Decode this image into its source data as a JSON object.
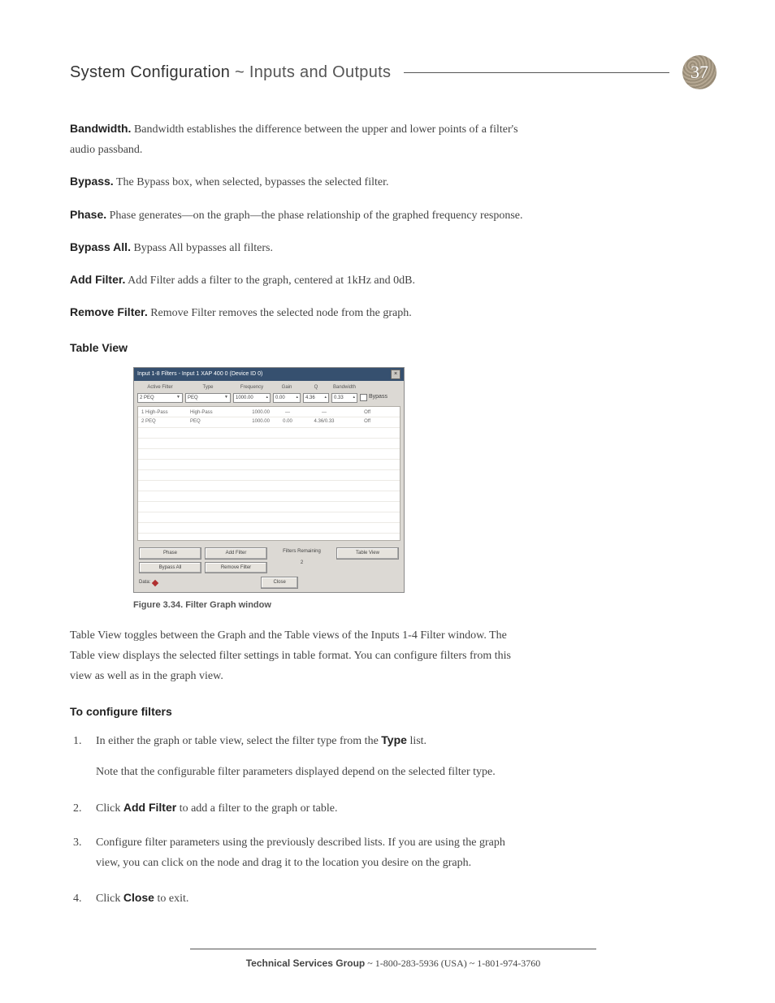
{
  "header": {
    "title_strong": "System Configuration",
    "title_sep": " ~ ",
    "title_light": "Inputs and Outputs",
    "page_number": "37"
  },
  "defs": [
    {
      "term": "Bandwidth.",
      "text": " Bandwidth establishes the difference between the upper and lower points of a filter's audio passband."
    },
    {
      "term": "Bypass.",
      "text": " The Bypass box, when selected, bypasses the selected filter."
    },
    {
      "term": "Phase.",
      "text": " Phase generates—on the graph—the phase relationship of the graphed frequency response."
    },
    {
      "term": "Bypass All.",
      "text": " Bypass All bypasses all filters."
    },
    {
      "term": "Add Filter.",
      "text": " Add Filter adds a filter to the graph, centered at 1kHz and 0dB."
    },
    {
      "term": "Remove Filter.",
      "text": " Remove Filter removes the selected node from the graph."
    }
  ],
  "table_view_head": "Table View",
  "table_view_para": "Table View toggles between the Graph and the Table views of the Inputs 1-4 Filter window. The Table view displays the selected filter settings in table format. You can configure filters from this view as well as in the graph view.",
  "configure_head": "To configure filters",
  "steps": {
    "s1a": "In either the graph or table view, select the filter type from the ",
    "s1bold": "Type",
    "s1b": " list.",
    "s1note": "Note that the configurable filter parameters displayed depend on the selected filter type.",
    "s2a": "Click ",
    "s2bold": "Add Filter",
    "s2b": " to add a filter to the graph or table.",
    "s3": "Configure filter parameters using the previously described lists. If you are using the graph view, you can click on the node and drag it to the location you desire on the graph.",
    "s4a": "Click ",
    "s4bold": "Close",
    "s4b": " to exit."
  },
  "figure": {
    "caption": "Figure 3.34. Filter Graph window",
    "win_title": "Input 1-8 Filters - Input 1  XAP 400 0 (Device ID 0)",
    "labels": {
      "active": "Active Filter",
      "type": "Type",
      "freq": "Frequency",
      "gain": "Gain",
      "q": "Q",
      "bw": "Bandwidth",
      "bypass": "Bypass"
    },
    "values": {
      "active": "2 PEQ",
      "type": "PEQ",
      "freq": "1000.00",
      "gain": "0.00",
      "q": "4.36",
      "bw": "0.33"
    },
    "rows": [
      {
        "c1": "1 High-Pass",
        "c2": "High-Pass",
        "c3": "1000.00",
        "c4": "—",
        "c5": "—",
        "c6": "Off"
      },
      {
        "c1": "2 PEQ",
        "c2": "PEQ",
        "c3": "1000.00",
        "c4": "0.00",
        "c5": "4.36/0.33",
        "c6": "Off"
      }
    ],
    "buttons": {
      "phase": "Phase",
      "bypass_all": "Bypass All",
      "add_filter": "Add Filter",
      "remove_filter": "Remove Filter",
      "table_view": "Table View",
      "close": "Close"
    },
    "rem": {
      "label": "Filters Remaining",
      "value": "2"
    },
    "data_label": "Data:"
  },
  "footer": {
    "group": "Technical Services Group",
    "sep1": " ~ ",
    "phone1": "1-800-283-5936 (USA)",
    "sep2": " ~ ",
    "phone2": "1-801-974-3760"
  }
}
